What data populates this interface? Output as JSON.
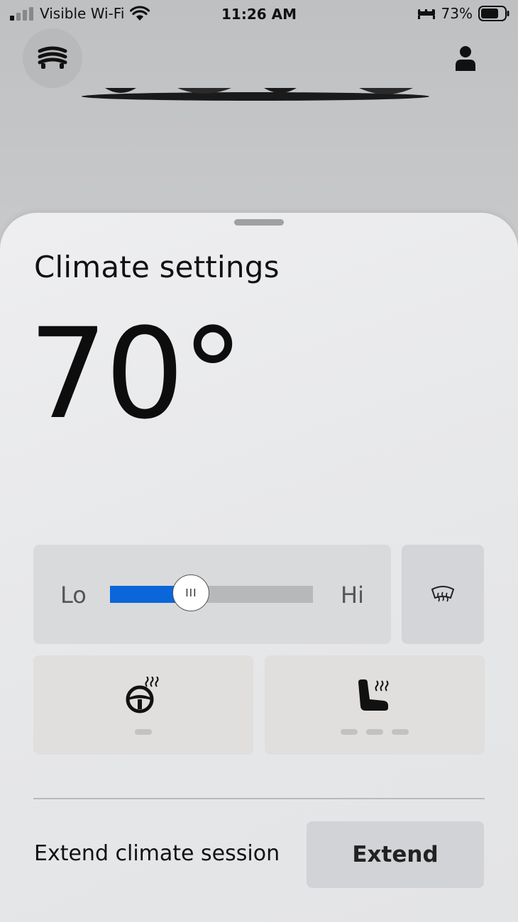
{
  "status_bar": {
    "carrier": "Visible Wi-Fi",
    "time": "11:26 AM",
    "battery_percent": "73%",
    "icons": [
      "signal-icon",
      "wifi-icon",
      "sleep-bed-icon",
      "battery-icon"
    ]
  },
  "header": {
    "menu_icon": "garage-menu-icon",
    "profile_icon": "person-icon"
  },
  "climate_sheet": {
    "title": "Climate settings",
    "temperature": "70°",
    "fan": {
      "lo_label": "Lo",
      "hi_label": "Hi",
      "level_fraction": 0.4,
      "thumb_glyph": "III",
      "accent_color": "#0A66D9"
    },
    "defrost_icon": "rear-defrost-icon",
    "steering_wheel_heat": {
      "icon": "heated-steering-wheel-icon",
      "levels_total": 1,
      "levels_active": 0
    },
    "seat_heat": {
      "icon": "heated-seat-icon",
      "levels_total": 3,
      "levels_active": 0
    },
    "extend_session": {
      "label": "Extend climate session",
      "button_label": "Extend"
    }
  }
}
